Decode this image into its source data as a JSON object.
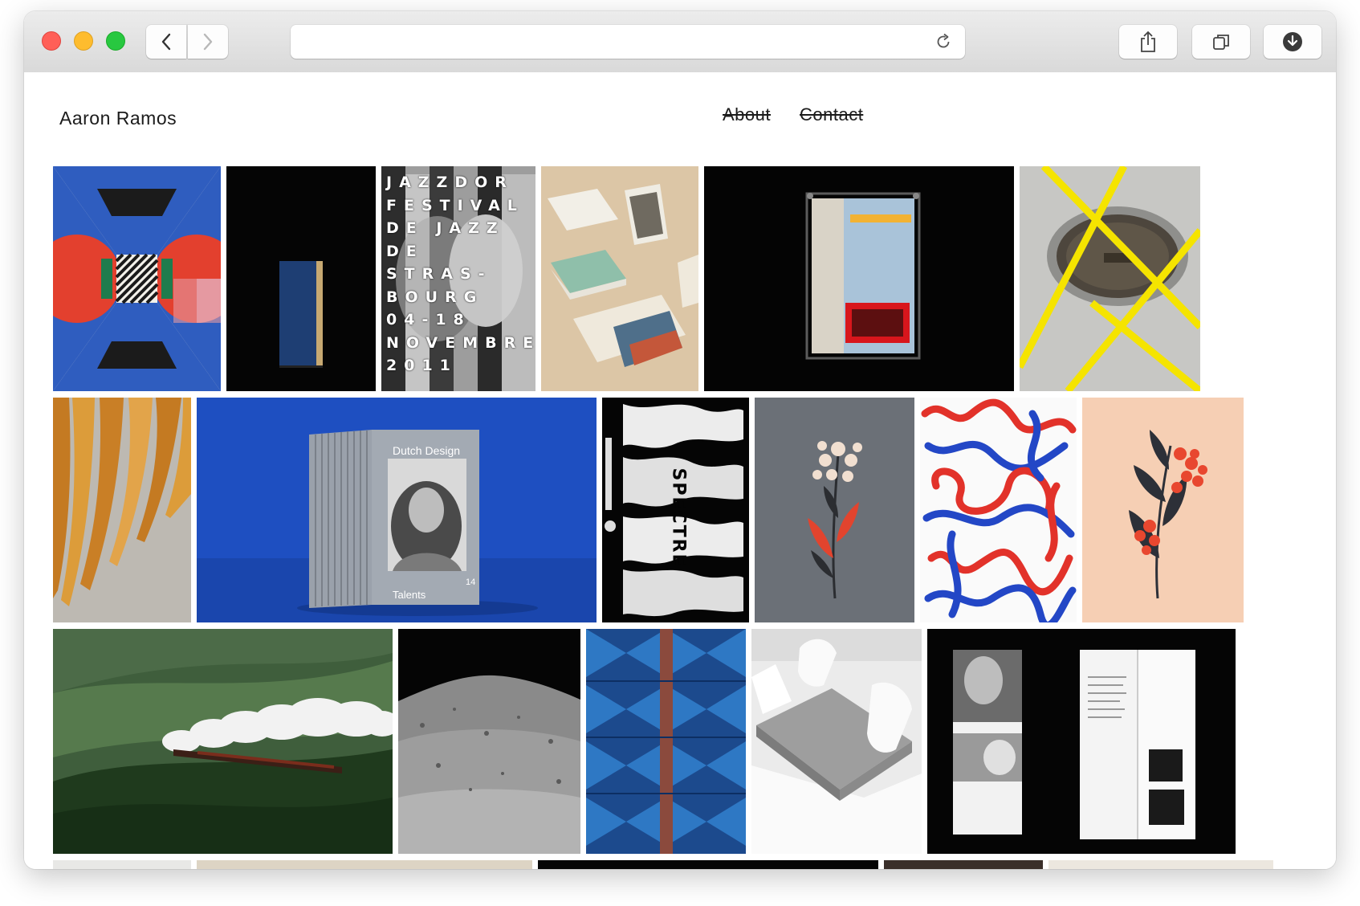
{
  "browser": {
    "address_value": "",
    "icons": {
      "back": "chevron-left-icon",
      "forward": "chevron-right-icon",
      "reload": "reload-icon",
      "share": "share-icon",
      "tabs": "tabs-icon",
      "download": "download-icon"
    }
  },
  "site": {
    "title": "Aaron Ramos",
    "nav": {
      "about": "About",
      "contact": "Contact"
    }
  },
  "tiles": {
    "jazz_poster": {
      "rows": [
        "JAZZDOR",
        "FESTIVAL",
        "DE JAZZ",
        "DE",
        "STRAS-",
        "BOURG",
        "04-18",
        "NOVEMBRE",
        "2011"
      ]
    },
    "dutch_design": {
      "title": "Dutch Design",
      "subtitle": "Talents",
      "number": "14"
    },
    "typo_poster": {
      "text": "SPECTRE"
    }
  },
  "colors": {
    "accent_blue": "#1e4fc1",
    "accent_red": "#e2322a",
    "accent_yellow": "#f5e400"
  }
}
